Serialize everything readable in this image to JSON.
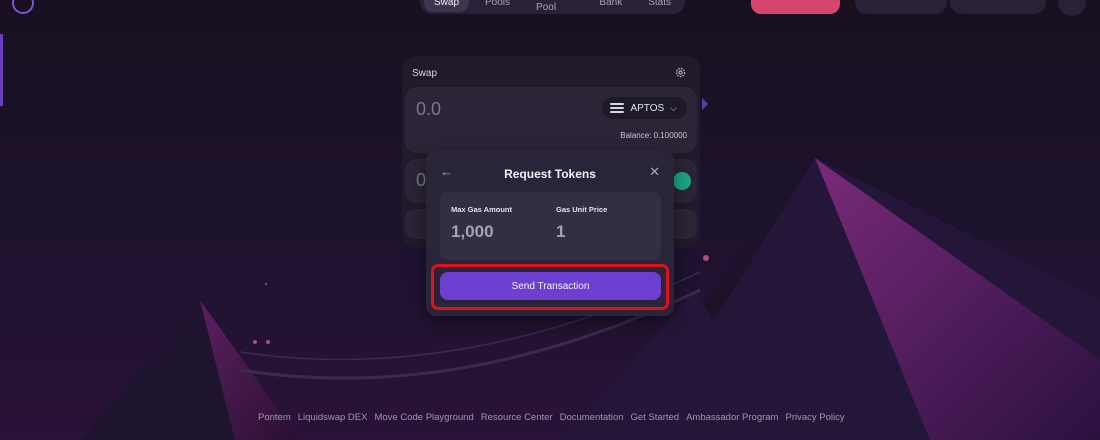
{
  "nav": {
    "items": [
      "Swap",
      "Pools",
      "Create Pool",
      "Bank",
      "Stats"
    ],
    "active_index": 0
  },
  "swap": {
    "title": "Swap",
    "from_amount": "0.0",
    "from_token": "APTOS",
    "balance": "Balance: 0.100000",
    "to_amount": "0"
  },
  "modal": {
    "title": "Request Tokens",
    "max_gas_label": "Max Gas Amount",
    "max_gas_value": "1,000",
    "gas_price_label": "Gas Unit Price",
    "gas_price_value": "1",
    "send_label": "Send Transaction"
  },
  "footer": {
    "links": [
      "Pontem",
      "Liquidswap DEX",
      "Move Code Playground",
      "Resource Center",
      "Documentation",
      "Get Started",
      "Ambassador Program",
      "Privacy Policy"
    ]
  },
  "colors": {
    "background": "#1a1126",
    "accent": "#6d3fd0",
    "highlight": "#e0101e",
    "pink": "#d6456e",
    "green": "#1aa884"
  },
  "icons": {
    "back": "arrow-left-icon",
    "close": "close-icon",
    "settings": "gear-icon",
    "token": "aptos-icon",
    "chevron": "chevron-down-icon"
  }
}
